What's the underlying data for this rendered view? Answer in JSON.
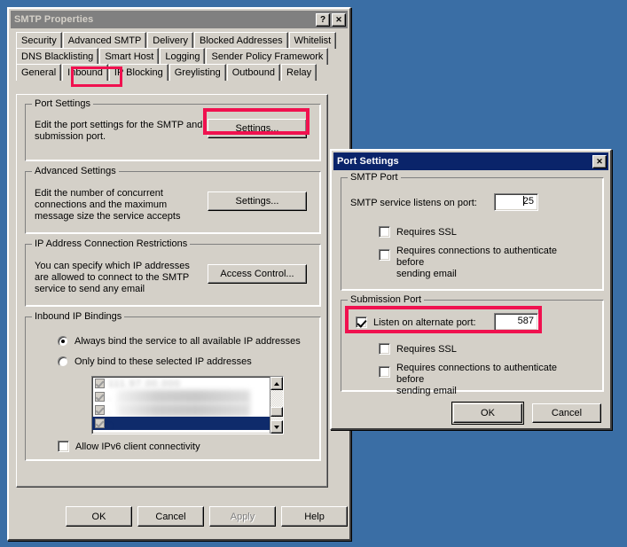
{
  "desktop": {
    "background_color": "#3a6ea5"
  },
  "annotation_color": "#f0114f",
  "main_window": {
    "title": "SMTP Properties",
    "titlebar_state": "inactive",
    "help_button": "?",
    "close_button": "✕",
    "tabs": [
      {
        "label": "Security",
        "selected": false,
        "row": 0
      },
      {
        "label": "Advanced SMTP",
        "selected": false,
        "row": 0
      },
      {
        "label": "Delivery",
        "selected": false,
        "row": 0
      },
      {
        "label": "Blocked Addresses",
        "selected": false,
        "row": 0
      },
      {
        "label": "Whitelist",
        "selected": false,
        "row": 0
      },
      {
        "label": "DNS Blacklisting",
        "selected": false,
        "row": 1
      },
      {
        "label": "Smart Host",
        "selected": false,
        "row": 1
      },
      {
        "label": "Logging",
        "selected": false,
        "row": 1
      },
      {
        "label": "Sender Policy Framework",
        "selected": false,
        "row": 1
      },
      {
        "label": "General",
        "selected": false,
        "row": 2
      },
      {
        "label": "Inbound",
        "selected": true,
        "row": 2
      },
      {
        "label": "IP Blocking",
        "selected": false,
        "row": 2
      },
      {
        "label": "Greylisting",
        "selected": false,
        "row": 2
      },
      {
        "label": "Outbound",
        "selected": false,
        "row": 2
      },
      {
        "label": "Relay",
        "selected": false,
        "row": 2
      }
    ],
    "groups": {
      "port_settings": {
        "title": "Port Settings",
        "description": "Edit the port settings for the SMTP and\nsubmission port.",
        "button_label": "Settings...",
        "highlighted": true
      },
      "advanced_settings": {
        "title": "Advanced Settings",
        "description": "Edit the number of concurrent\nconnections and the maximum\nmessage size the service accepts",
        "button_label": "Settings..."
      },
      "ip_restrictions": {
        "title": "IP Address Connection Restrictions",
        "description": "You can specify which IP addresses\nare allowed to connect to the SMTP\nservice to send any email",
        "button_label": "Access Control..."
      },
      "inbound_bindings": {
        "title": "Inbound IP Bindings",
        "radio_all": {
          "label": "Always bind the service to all available IP addresses",
          "checked": true
        },
        "radio_selected": {
          "label": "Only bind to these selected IP addresses",
          "checked": false
        },
        "ip_list": [
          {
            "value": "",
            "checked": true,
            "selected": false,
            "redacted": true
          },
          {
            "value": "",
            "checked": true,
            "selected": false,
            "redacted": true
          },
          {
            "value": "",
            "checked": true,
            "selected": false,
            "redacted": true
          },
          {
            "value": "",
            "checked": true,
            "selected": true,
            "redacted": true
          }
        ],
        "ipv6_checkbox": {
          "label": "Allow IPv6 client connectivity",
          "checked": false
        }
      }
    },
    "footer_buttons": [
      {
        "label": "OK",
        "disabled": false
      },
      {
        "label": "Cancel",
        "disabled": false
      },
      {
        "label": "Apply",
        "disabled": true
      },
      {
        "label": "Help",
        "disabled": false
      }
    ]
  },
  "port_settings_dialog": {
    "title": "Port Settings",
    "titlebar_state": "active",
    "close_button": "✕",
    "smtp_port_group": {
      "title": "SMTP Port",
      "port_label": "SMTP service listens on port:",
      "port_value": "25",
      "requires_ssl": {
        "label": "Requires SSL",
        "checked": false
      },
      "requires_auth": {
        "label": "Requires connections to authenticate before\nsending email",
        "checked": false
      }
    },
    "submission_port_group": {
      "title": "Submission Port",
      "listen_alternate": {
        "label": "Listen on alternate port:",
        "checked": true
      },
      "port_value": "587",
      "highlighted": true,
      "requires_ssl": {
        "label": "Requires SSL",
        "checked": false
      },
      "requires_auth": {
        "label": "Requires connections to authenticate before\nsending email",
        "checked": false
      }
    },
    "buttons": [
      {
        "label": "OK",
        "default": true
      },
      {
        "label": "Cancel",
        "default": false
      }
    ]
  }
}
